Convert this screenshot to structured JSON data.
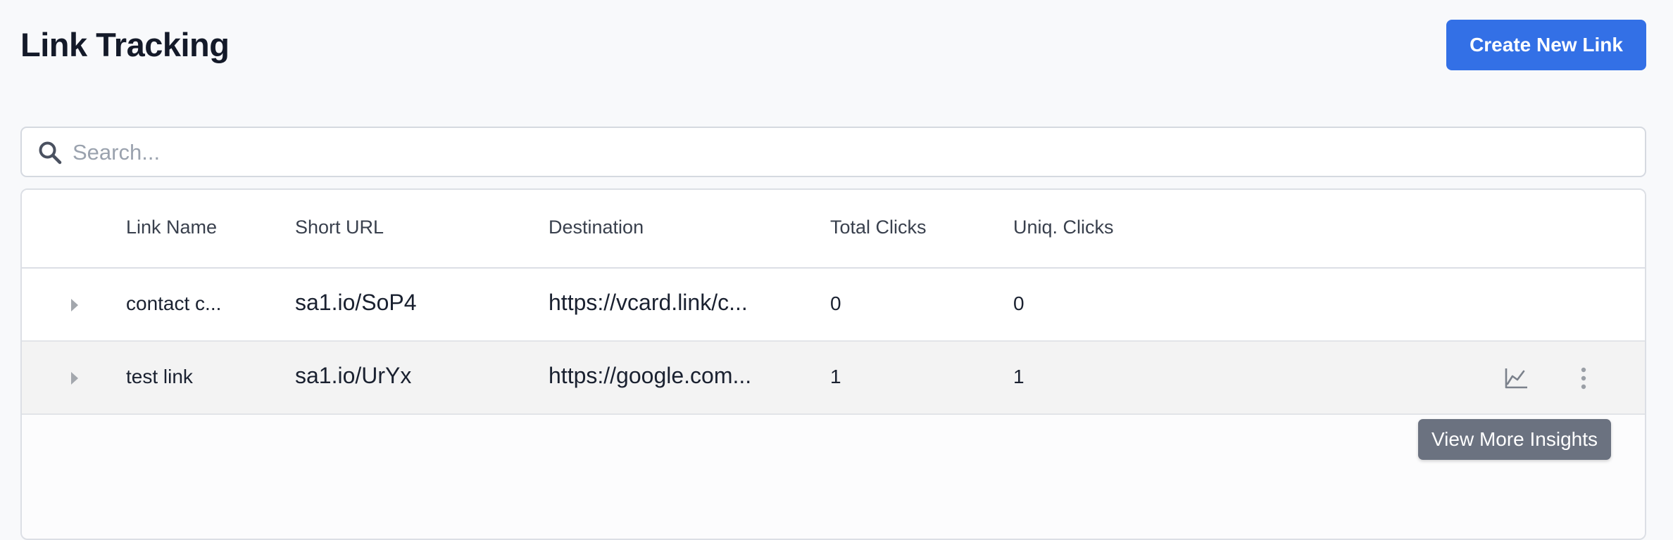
{
  "header": {
    "title": "Link Tracking",
    "create_button_label": "Create New Link"
  },
  "search": {
    "placeholder": "Search...",
    "value": ""
  },
  "table": {
    "columns": [
      "Link Name",
      "Short URL",
      "Destination",
      "Total Clicks",
      "Uniq. Clicks"
    ],
    "rows": [
      {
        "name": "contact c...",
        "short_url": "sa1.io/SoP4",
        "destination": "https://vcard.link/c...",
        "total_clicks": "0",
        "unique_clicks": "0"
      },
      {
        "name": "test link",
        "short_url": "sa1.io/UrYx",
        "destination": "https://google.com...",
        "total_clicks": "1",
        "unique_clicks": "1"
      }
    ]
  },
  "tooltip": {
    "text": "View More Insights"
  },
  "icons": {
    "search": "search-icon",
    "expand": "caret-right-icon",
    "insights": "line-chart-icon",
    "more": "vertical-ellipsis-icon"
  },
  "colors": {
    "primary": "#3370e6",
    "hover_row": "#f3f3f3",
    "tooltip_bg": "#6b7280"
  }
}
